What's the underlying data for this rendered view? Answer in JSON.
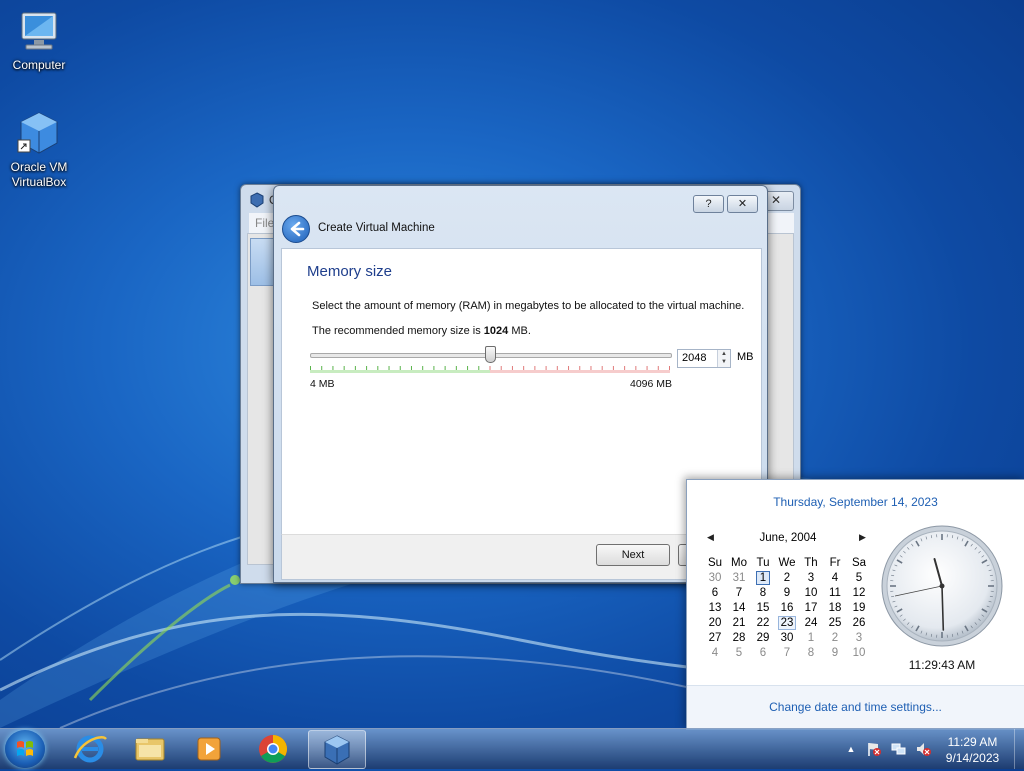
{
  "desktop": {
    "icons": [
      {
        "label": "Computer"
      },
      {
        "label_line1": "Oracle VM",
        "label_line2": "VirtualBox"
      }
    ]
  },
  "background_window": {
    "title_initial": "O",
    "menu_partial": "File",
    "close_glyph": "✕"
  },
  "dialog": {
    "help_glyph": "?",
    "close_glyph": "✕",
    "title": "Create Virtual Machine",
    "page_title": "Memory size",
    "description": "Select the amount of memory (RAM) in megabytes to be allocated to the virtual machine.",
    "recommended_prefix": "The recommended memory size is ",
    "recommended_value": "1024",
    "recommended_suffix": " MB.",
    "memory": {
      "value": 2048,
      "min": 4,
      "max": 4096,
      "display": "2048",
      "unit": "MB"
    },
    "min_label": "4 MB",
    "max_label": "4096 MB",
    "next_label": "Next"
  },
  "flyout": {
    "long_date": "Thursday, September 14, 2023",
    "calendar": {
      "month_label": "June, 2004",
      "prev_glyph": "◀",
      "next_glyph": "▶",
      "weekdays": [
        "Su",
        "Mo",
        "Tu",
        "We",
        "Th",
        "Fr",
        "Sa"
      ],
      "weeks": [
        [
          {
            "d": "30",
            "o": true
          },
          {
            "d": "31",
            "o": true
          },
          {
            "d": "1",
            "s": "today"
          },
          {
            "d": "2"
          },
          {
            "d": "3"
          },
          {
            "d": "4"
          },
          {
            "d": "5"
          }
        ],
        [
          {
            "d": "6"
          },
          {
            "d": "7"
          },
          {
            "d": "8"
          },
          {
            "d": "9"
          },
          {
            "d": "10"
          },
          {
            "d": "11"
          },
          {
            "d": "12"
          }
        ],
        [
          {
            "d": "13"
          },
          {
            "d": "14"
          },
          {
            "d": "15"
          },
          {
            "d": "16"
          },
          {
            "d": "17"
          },
          {
            "d": "18"
          },
          {
            "d": "19"
          }
        ],
        [
          {
            "d": "20"
          },
          {
            "d": "21"
          },
          {
            "d": "22"
          },
          {
            "d": "23",
            "s": "hover"
          },
          {
            "d": "24"
          },
          {
            "d": "25"
          },
          {
            "d": "26"
          }
        ],
        [
          {
            "d": "27"
          },
          {
            "d": "28"
          },
          {
            "d": "29"
          },
          {
            "d": "30"
          },
          {
            "d": "1",
            "o": true
          },
          {
            "d": "2",
            "o": true
          },
          {
            "d": "3",
            "o": true
          }
        ],
        [
          {
            "d": "4",
            "o": true
          },
          {
            "d": "5",
            "o": true
          },
          {
            "d": "6",
            "o": true
          },
          {
            "d": "7",
            "o": true
          },
          {
            "d": "8",
            "o": true
          },
          {
            "d": "9",
            "o": true
          },
          {
            "d": "10",
            "o": true
          }
        ]
      ]
    },
    "clock": {
      "hours": 11,
      "minutes": 29,
      "seconds": 43
    },
    "clock_text": "11:29:43 AM",
    "settings_link": "Change date and time settings..."
  },
  "taskbar": {
    "apps": [
      "start-orb",
      "internet-explorer",
      "windows-explorer",
      "media-player",
      "chrome",
      "virtualbox"
    ],
    "active_app": "virtualbox",
    "tray_expand_glyph": "▲",
    "time": "11:29 AM",
    "date": "9/14/2023"
  }
}
